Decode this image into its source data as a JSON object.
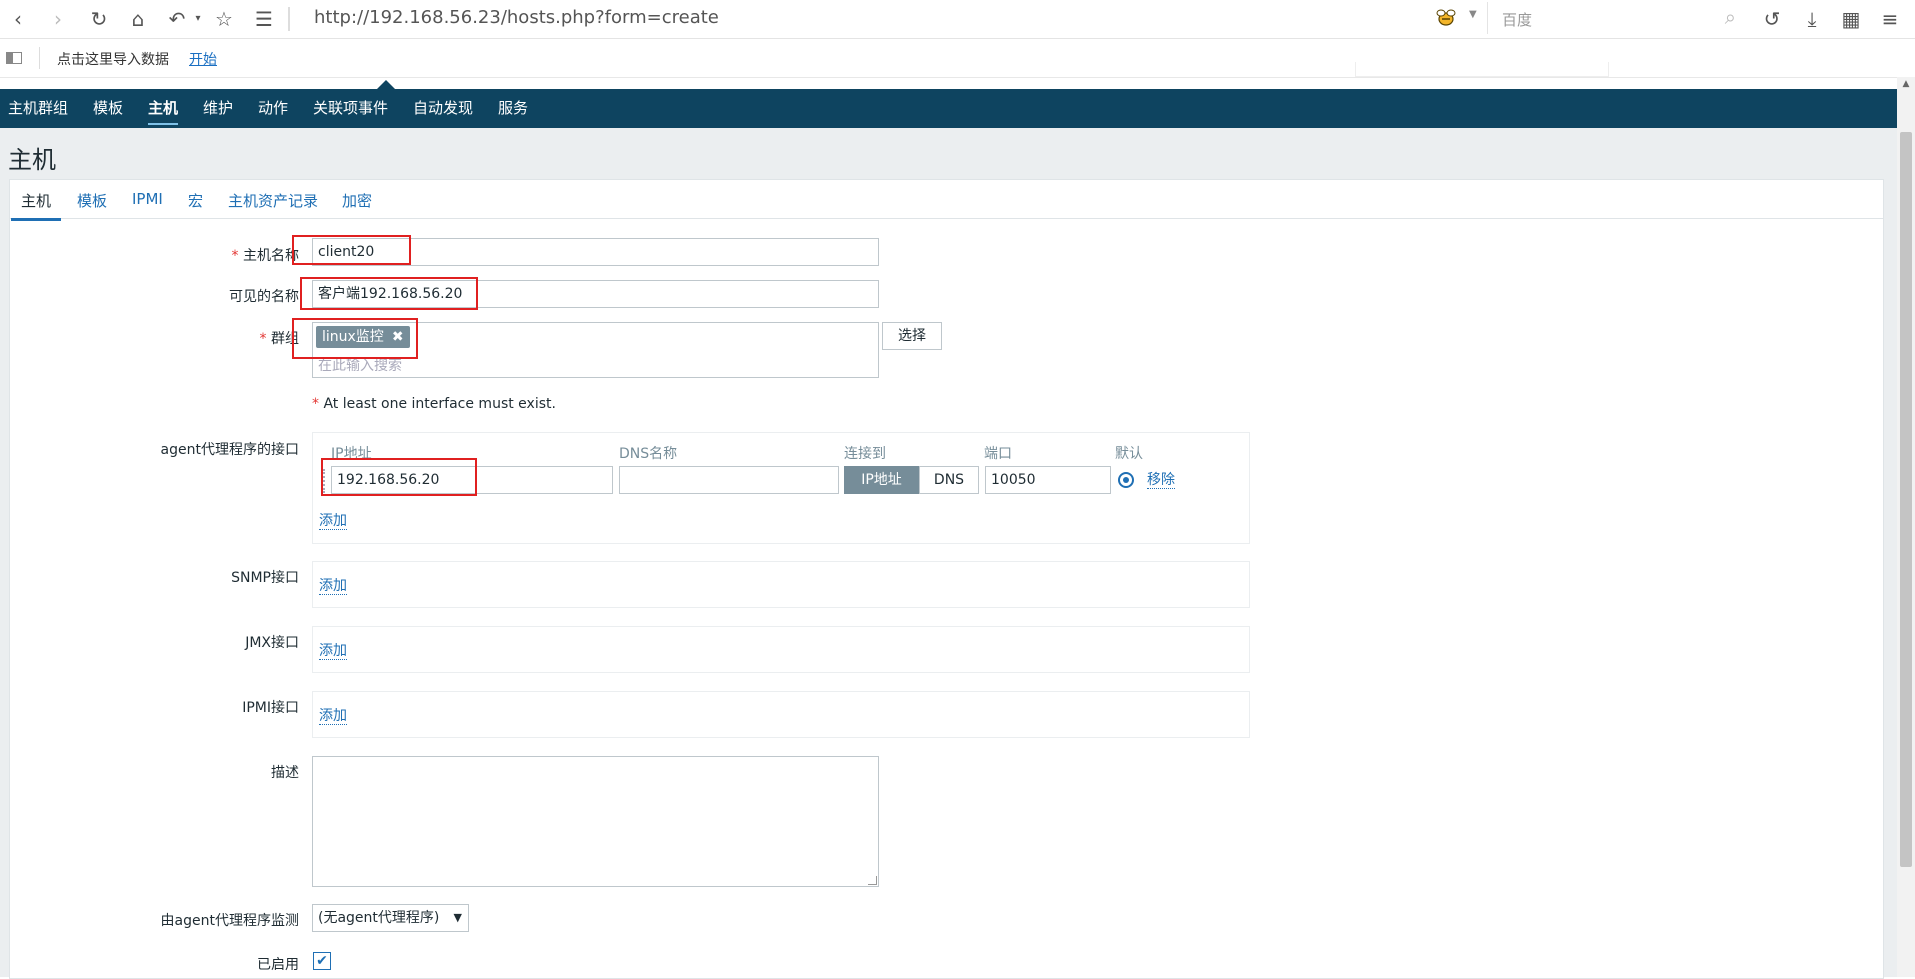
{
  "browser": {
    "url": "http://192.168.56.23/hosts.php?form=create",
    "search_placeholder": "百度",
    "bookmark_text": "点击这里导入数据",
    "bookmark_link": "开始"
  },
  "nav": {
    "items": [
      "主机群组",
      "模板",
      "主机",
      "维护",
      "动作",
      "关联项事件",
      "自动发现",
      "服务"
    ],
    "active": "主机"
  },
  "page": {
    "title": "主机"
  },
  "tabs": [
    "主机",
    "模板",
    "IPMI",
    "宏",
    "主机资产记录",
    "加密"
  ],
  "form": {
    "host_name_label": "主机名称",
    "host_name_value": "client20",
    "visible_name_label": "可见的名称",
    "visible_name_value": "客户端192.168.56.20",
    "groups_label": "群组",
    "group_chip": "linux监控",
    "group_chip_remove": "✖",
    "groups_placeholder": "在此输入搜索",
    "select_button": "选择",
    "required_mark": "*",
    "interface_warning": "At least one interface must exist.",
    "agent_label": "agent代理程序的接口",
    "col_ip": "IP地址",
    "col_dns": "DNS名称",
    "col_connect": "连接到",
    "col_port": "端口",
    "col_default": "默认",
    "agent_ip": "192.168.56.20",
    "agent_dns": "",
    "connect_ip": "IP地址",
    "connect_dns": "DNS",
    "agent_port": "10050",
    "remove_link": "移除",
    "add_link": "添加",
    "snmp_label": "SNMP接口",
    "jmx_label": "JMX接口",
    "ipmi_label": "IPMI接口",
    "description_label": "描述",
    "proxy_label": "由agent代理程序监测",
    "proxy_value": "(无agent代理程序)",
    "enabled_label": "已启用",
    "enabled_check": "✔"
  },
  "colors": {
    "nav_bg": "#0e4460",
    "accent": "#1f6fb4",
    "highlight_box": "#e02020"
  }
}
